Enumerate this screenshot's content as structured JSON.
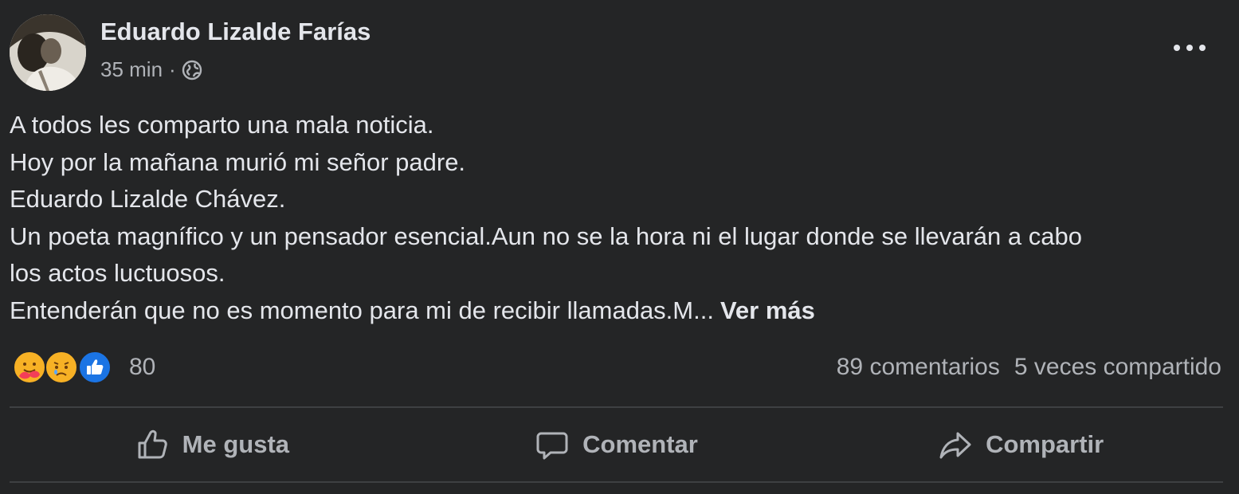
{
  "post": {
    "author_name": "Eduardo Lizalde Farías",
    "timestamp": "35 min",
    "separator": "·",
    "privacy_icon": "globe-icon",
    "more_icon": "more-options-icon",
    "body_lines": [
      "A todos les comparto una mala noticia.",
      "Hoy por la mañana murió mi señor padre.",
      "Eduardo Lizalde Chávez.",
      "Un poeta magnífico y un pensador esencial.Aun no se la hora ni el lugar donde se llevarán a cabo",
      "los actos luctuosos.",
      "Entenderán que no es momento para mi de recibir llamadas.M..."
    ],
    "see_more": "Ver más"
  },
  "reactions": {
    "icons": [
      "care-reaction-icon",
      "sad-reaction-icon",
      "like-reaction-icon"
    ],
    "count": "80"
  },
  "stats": {
    "comments": "89 comentarios",
    "shares": "5 veces compartido"
  },
  "actions": {
    "like": "Me gusta",
    "comment": "Comentar",
    "share": "Compartir"
  },
  "colors": {
    "background": "#242526",
    "primary_text": "#e4e6eb",
    "secondary_text": "#b0b3b8",
    "divider": "#3e4042",
    "like_blue": "#1b74e4",
    "reaction_yellow": "#f7b125"
  }
}
